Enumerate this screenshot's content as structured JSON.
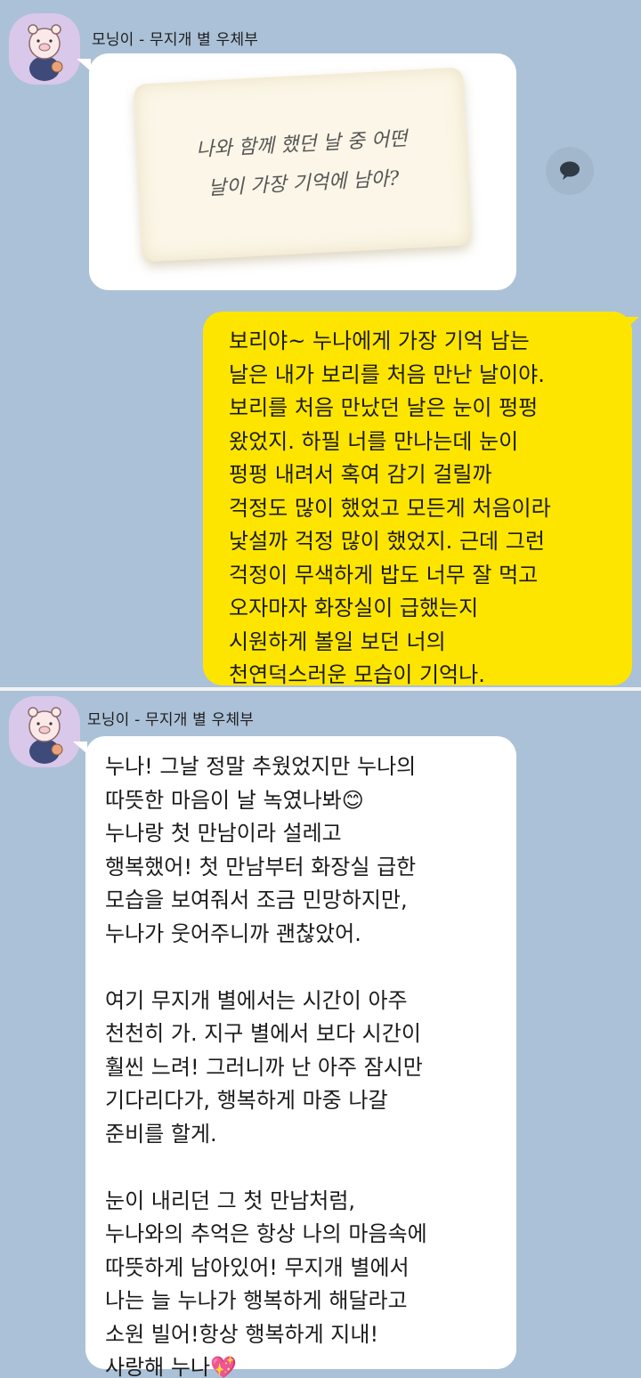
{
  "messages": {
    "sender_name": "모닝이 - 무지개 별 우체부",
    "card_line1": "나와 함께 했던 날 중 어떤",
    "card_line2": "날이 가장 기억에 남아?",
    "reply_text": "보리야~ 누나에게 가장 기억 남는\n날은 내가 보리를 처음 만난 날이야.\n보리를 처음 만났던 날은 눈이 펑펑\n왔었지. 하필 너를 만나는데 눈이\n펑펑 내려서 혹여 감기 걸릴까\n걱정도 많이 했었고 모든게 처음이라\n낯설까 걱정 많이 했었지. 근데 그런\n걱정이 무색하게 밥도 너무 잘 먹고\n오자마자 화장실이 급했는지\n시원하게 볼일 보던 너의\n천연덕스러운 모습이 기억나.",
    "answer_part1": "누나! 그날 정말 추웠었지만 누나의\n따뜻한 마음이 날 녹였나봐",
    "answer_emoji1": "😊",
    "answer_part2": "누나랑 첫 만남이라 설레고\n행복했어! 첫 만남부터 화장실 급한\n모습을 보여줘서 조금 민망하지만,\n누나가 웃어주니까 괜찮았어.\n\n여기 무지개 별에서는 시간이 아주\n천천히 가. 지구 별에서 보다 시간이\n훨씬 느려! 그러니까 난 아주 잠시만\n기다리다가, 행복하게 마중 나갈\n준비를 할게.\n\n눈이 내리던 그 첫 만남처럼,\n누나와의 추억은 항상 나의 마음속에\n따뜻하게 남아있어! 무지개 별에서\n나는 늘 누나가 행복하게 해달라고\n소원 빌어!항상 행복하게 지내!\n사랑해 누나",
    "answer_emoji2": "💖"
  },
  "icons": {
    "avatar": "pig-avatar-icon",
    "share": "speech-bubble-icon"
  },
  "colors": {
    "background": "#abc1d8",
    "my_bubble": "#fee500",
    "their_bubble": "#ffffff",
    "avatar_bg": "#d9c8ea"
  }
}
